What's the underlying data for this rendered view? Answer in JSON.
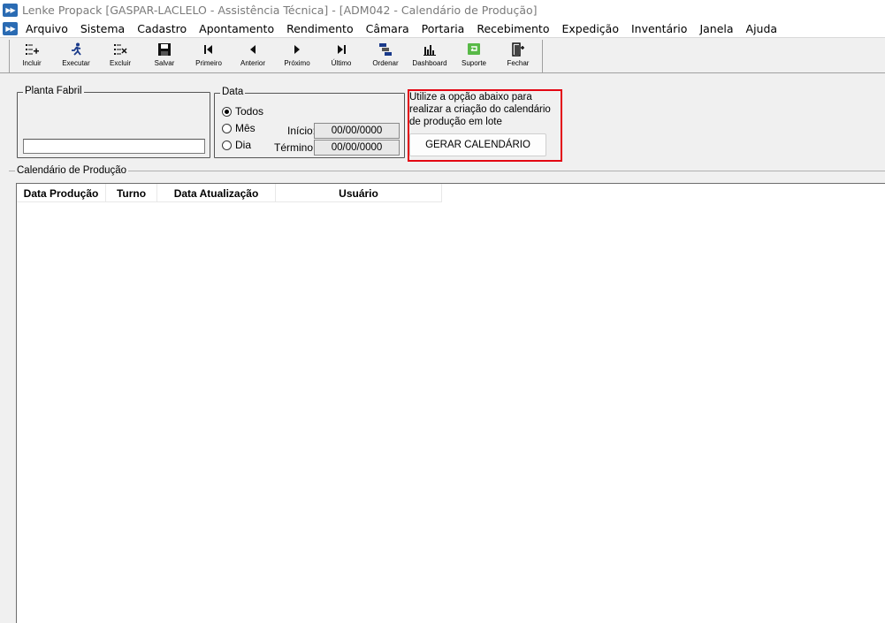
{
  "window": {
    "title": "Lenke Propack [GASPAR-LACLELO - Assistência Técnica] - [ADM042 - Calendário de Produção]",
    "app_icon": "lenke-logo-icon"
  },
  "menu": [
    "Arquivo",
    "Sistema",
    "Cadastro",
    "Apontamento",
    "Rendimento",
    "Câmara",
    "Portaria",
    "Recebimento",
    "Expedição",
    "Inventário",
    "Janela",
    "Ajuda"
  ],
  "toolbar": {
    "buttons": [
      {
        "label": "Incluir",
        "icon": "list-add-icon"
      },
      {
        "label": "Executar",
        "icon": "run-icon"
      },
      {
        "label": "Excluir",
        "icon": "list-delete-icon"
      },
      {
        "label": "Salvar",
        "icon": "floppy-disk-icon"
      },
      {
        "label": "Primeiro",
        "icon": "first-record-icon"
      },
      {
        "label": "Anterior",
        "icon": "previous-record-icon"
      },
      {
        "label": "Próximo",
        "icon": "next-record-icon"
      },
      {
        "label": "Último",
        "icon": "last-record-icon"
      },
      {
        "label": "Ordenar",
        "icon": "sort-icon"
      },
      {
        "label": "Dashboard",
        "icon": "bar-chart-icon"
      },
      {
        "label": "Suporte",
        "icon": "support-icon"
      },
      {
        "label": "Fechar",
        "icon": "exit-door-icon"
      }
    ]
  },
  "filters": {
    "plant": {
      "legend": "Planta Fabril",
      "value": ""
    },
    "date": {
      "legend": "Data",
      "options": [
        {
          "label": "Todos",
          "checked": true
        },
        {
          "label": "Mês",
          "checked": false
        },
        {
          "label": "Dia",
          "checked": false
        }
      ],
      "start_label": "Início:",
      "start_value": "00/00/0000",
      "end_label": "Término:",
      "end_value": "00/00/0000"
    }
  },
  "generate": {
    "hint": "Utilize a opção abaixo para realizar a criação do calendário de produção em lote",
    "button_label": "GERAR CALENDÁRIO",
    "highlight_color": "#e30613"
  },
  "calendar": {
    "section_label": "Calendário de Produção",
    "columns": [
      "Data Produção",
      "Turno",
      "Data Atualização",
      "Usuário"
    ],
    "rows": []
  }
}
